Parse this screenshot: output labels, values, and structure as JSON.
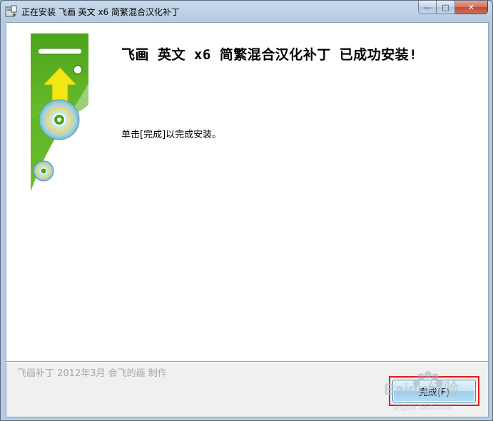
{
  "window": {
    "title": "正在安装 飞画 英文 x6 简繁混合汉化补丁"
  },
  "captions": {
    "minimize": "—",
    "maximize": "□",
    "close": "✕"
  },
  "content": {
    "heading": "飞画 英文 x6 简繁混合汉化补丁 已成功安装!",
    "instruction": "单击[完成]以完成安装。"
  },
  "footer": {
    "credit": "飞画补丁  2012年3月 会飞的画 制作",
    "finish_button": "完成(F)"
  },
  "watermark": {
    "text": "Baidu经验",
    "url": "jingyan.baidu.com"
  },
  "colors": {
    "banner_green": "#5fb423",
    "arrow_yellow": "#f2e614",
    "highlight_red": "#e1191d"
  }
}
